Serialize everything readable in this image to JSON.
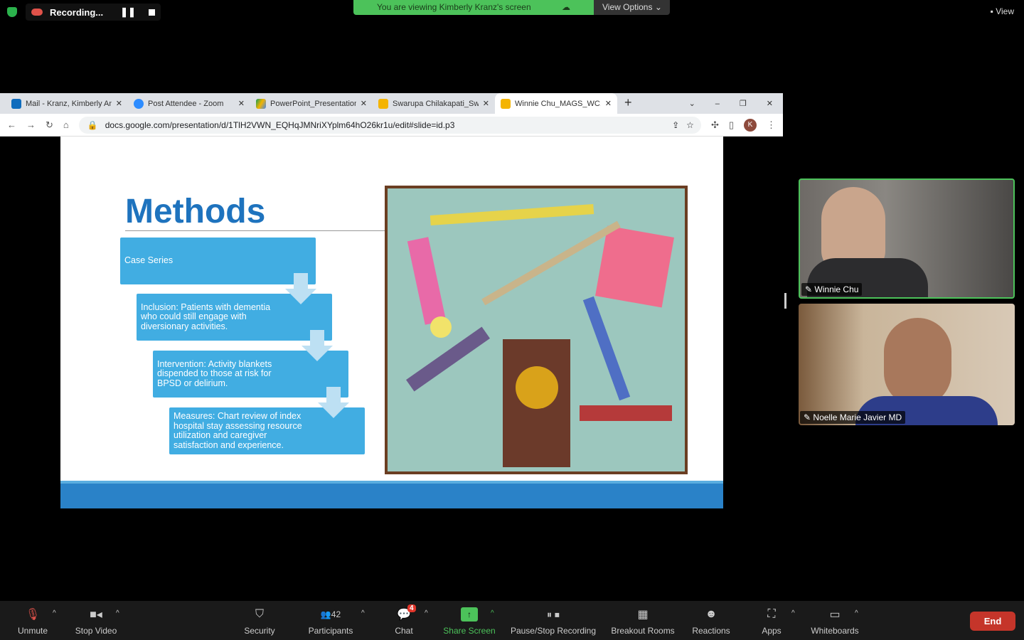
{
  "zoom": {
    "recording": "Recording...",
    "banner": "You are viewing Kimberly Kranz's screen",
    "view_options": "View Options",
    "view": "View"
  },
  "browser": {
    "tabs": [
      {
        "title": "Mail - Kranz, Kimberly Ann",
        "color": "#0f6cbd"
      },
      {
        "title": "Post Attendee - Zoom",
        "color": "#2d8cff"
      },
      {
        "title": "PowerPoint_Presentations",
        "color": "#f4b400"
      },
      {
        "title": "Swarupa Chilakapati_Swarupa",
        "color": "#f4b400"
      },
      {
        "title": "Winnie Chu_MAGS_WC.pptx",
        "color": "#f4b400"
      }
    ],
    "url": "docs.google.com/presentation/d/1TlH2VWN_EQHqJMNriXYplm64hO26kr1u/edit#slide=id.p3",
    "profile": "K"
  },
  "slide": {
    "title": "Methods",
    "boxes": [
      "Case Series",
      "Inclusion: Patients with dementia who could still engage with diversionary activities.",
      "Intervention: Activity blankets dispended to those at risk for BPSD or delirium.",
      "Measures: Chart review of index hospital stay assessing resource utilization and caregiver satisfaction and experience."
    ]
  },
  "participants": [
    {
      "name": "Winnie Chu"
    },
    {
      "name": "Noelle Marie Javier MD"
    }
  ],
  "toolbar": {
    "unmute": "Unmute",
    "stop_video": "Stop Video",
    "security": "Security",
    "participants": "Participants",
    "participant_count": "42",
    "chat": "Chat",
    "chat_badge": "4",
    "share": "Share Screen",
    "pause_stop": "Pause/Stop Recording",
    "breakout": "Breakout Rooms",
    "reactions": "Reactions",
    "apps": "Apps",
    "whiteboards": "Whiteboards",
    "end": "End"
  }
}
